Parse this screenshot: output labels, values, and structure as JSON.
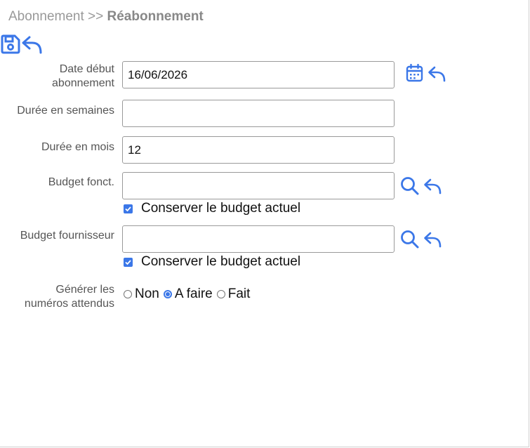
{
  "breadcrumb": {
    "parent": "Abonnement",
    "separator": ">>",
    "current": "Réabonnement"
  },
  "colors": {
    "accent": "#3b77e8"
  },
  "icons": {
    "save": "save-icon",
    "undo": "undo-icon",
    "calendar": "calendar-icon",
    "search": "search-icon"
  },
  "form": {
    "date_debut": {
      "label_line1": "Date début",
      "label_line2": "abonnement",
      "value": "16/06/2026"
    },
    "duree_semaines": {
      "label": "Durée en semaines",
      "value": ""
    },
    "duree_mois": {
      "label": "Durée en mois",
      "value": "12"
    },
    "budget_fonct": {
      "label": "Budget fonct.",
      "value": "",
      "keep_label": "Conserver le budget actuel",
      "keep_checked": true
    },
    "budget_fournisseur": {
      "label": "Budget fournisseur",
      "value": "",
      "keep_label": "Conserver le budget actuel",
      "keep_checked": true
    },
    "generer": {
      "label_line1": "Générer les",
      "label_line2": "numéros attendus",
      "options": [
        "Non",
        "A faire",
        "Fait"
      ],
      "selected": "A faire"
    }
  }
}
